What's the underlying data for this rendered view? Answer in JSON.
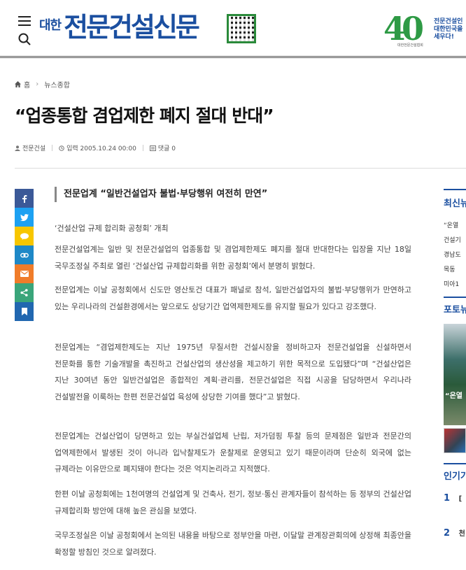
{
  "header": {
    "logo_small": "대한",
    "logo_big": "전문건설신문",
    "anniversary_number": "40",
    "anniversary_text": "전문건설인 대한민국을 세우다!",
    "anniversary_sub": "대한전문건설협회"
  },
  "breadcrumb": {
    "home": "홈",
    "section": "뉴스종합"
  },
  "article": {
    "title": "“업종통합 겸업제한 폐지 절대 반대”",
    "author": "전문건설",
    "date": "입력 2005.10.24 00:00",
    "comments": "댓글 0",
    "subheading": "전문업계 “일반건설업자 불법·부당행위 여전히 만연”",
    "event": "‘건설산업 규제 합리화 공청회’ 개최",
    "paragraphs": [
      "전문건설업계는 일반 및 전문건설업의 업종통합 및 겸업제한제도 폐지를 절대 반대한다는 입장을 지난 18일 국무조정실 주최로 열린 ‘건설산업 규제합리화를 위한 공청회’에서 분명히 밝혔다.",
      "전문업계는 이날 공청회에서 신도만 영산토건 대표가 패널로 참석, 일반건설업자의 불법·부당행위가 만연하고 있는 우리나라의 건설환경에서는 앞으로도 상당기간 업역제한제도를 유지할 필요가 있다고 강조했다.",
      "전문업계는 “겸업제한제도는 지난 1975년 무질서한 건설시장을 정비하고자 전문건설업을 신설하면서 전문화를 통한 기술개발을 촉진하고 건설산업의 생산성을 제고하기 위한 목적으로 도입됐다”며 “건설산업은 지난 30여년 동안 일반건설업은 종합적인 계획·관리를, 전문건설업은 직접 시공을 담당하면서 우리나라 건설발전을 이룩하는 한편 전문건설업 육성에 상당한 기여를 했다”고 밝혔다.",
      "전문업계는 건설산업이 당면하고 있는 부실건설업체 난립, 저가덤핑 투찰 등의 문제점은 일반과 전문간의 업역제한에서 발생된 것이 아니라 입낙찰제도가 운찰제로 운영되고 있기 때문이라며 단순히 외국에 없는 규제라는 이유만으로 폐지돼야 한다는 것은 억지논리라고 지적했다.",
      "한편 이날 공청회에는 1천여명의 건설업계 및 건축사, 전기, 정보·통신 관계자들이 참석하는 등 정부의 건설산업 규제합리화 방안에 대해 높은 관심을 보였다.",
      "국무조정실은 이날 공청회에서 논의된 내용을 바탕으로 정부안을 마련, 이달말 관계장관회의에 상정해 최종안을 확정할 방침인 것으로 알려졌다."
    ]
  },
  "share_buttons": [
    {
      "name": "facebook",
      "color": "#3b5998"
    },
    {
      "name": "twitter",
      "color": "#1da1f2"
    },
    {
      "name": "kakaostory",
      "color": "#f7c600"
    },
    {
      "name": "link",
      "color": "#1e88c7"
    },
    {
      "name": "email",
      "color": "#f07c2a"
    },
    {
      "name": "share",
      "color": "#3aa57a"
    },
    {
      "name": "bookmark",
      "color": "#2167b0"
    }
  ],
  "sidebar": {
    "latest_title": "최신뉴",
    "latest_items": [
      "“온열",
      "건설기",
      "경남도",
      "목동 ",
      "미아1"
    ],
    "photo_title": "포토뉴",
    "photo_caption": "“온열",
    "popular_title": "인기기",
    "popular": [
      {
        "rank": "1",
        "text": "["
      },
      {
        "rank": "2",
        "text": "천"
      }
    ]
  }
}
